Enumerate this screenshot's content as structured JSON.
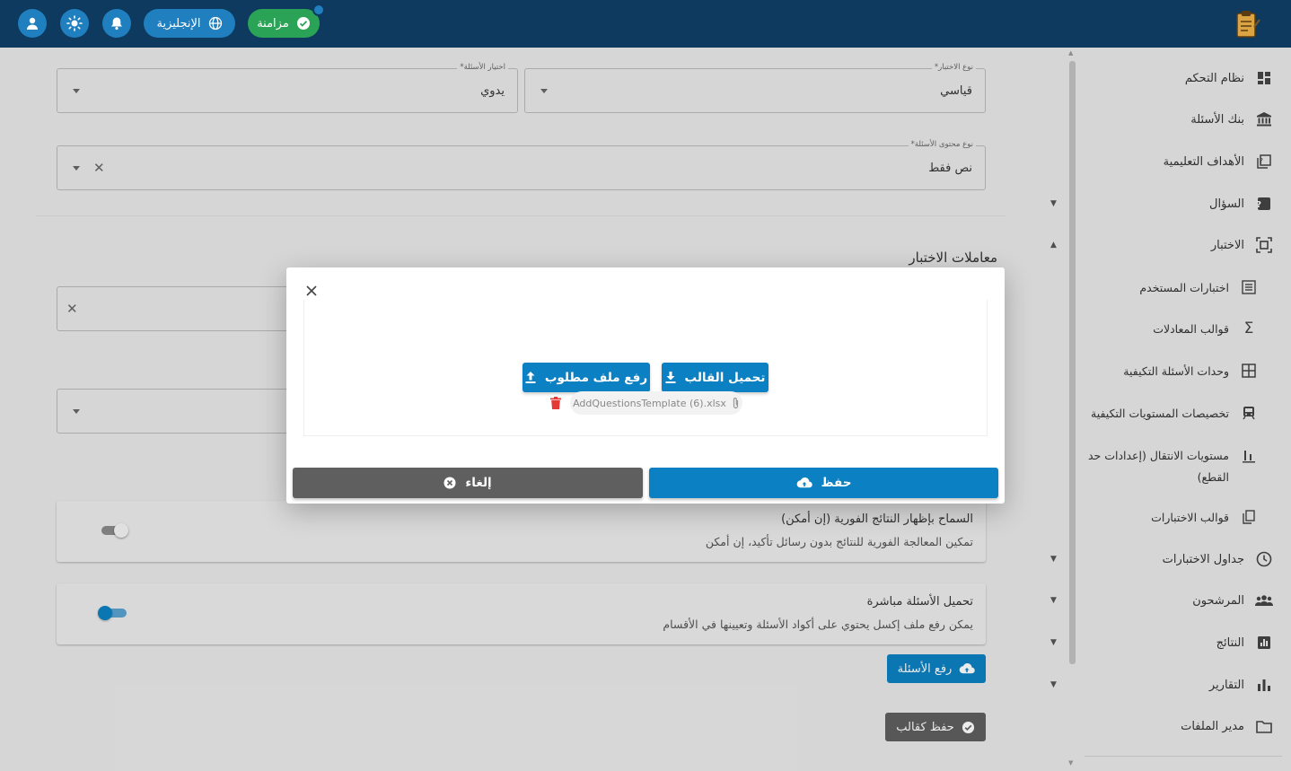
{
  "topbar": {
    "sync_label": "مزامنة",
    "language_label": "الإنجليزية",
    "colors": {
      "bar": "#0e3a5f",
      "accent": "#1f7fbf",
      "sync": "#2aa356"
    }
  },
  "sidebar": {
    "items": [
      {
        "label": "نظام التحكم",
        "icon": "dashboard-icon"
      },
      {
        "label": "بنك الأسئلة",
        "icon": "bank-icon"
      },
      {
        "label": "الأهداف التعليمية",
        "icon": "book-question-icon"
      },
      {
        "label": "السؤال",
        "icon": "question-icon",
        "expandable": true
      },
      {
        "label": "الاختبار",
        "icon": "exam-icon",
        "expanded": true
      },
      {
        "label": "اختبارات المستخدم",
        "icon": "list-icon",
        "sub": true
      },
      {
        "label": "قوالب المعادلات",
        "icon": "sigma-icon",
        "sub": true
      },
      {
        "label": "وحدات الأسئلة التكيفية",
        "icon": "grid-icon",
        "sub": true
      },
      {
        "label": "تخصيصات المستويات التكيفية",
        "icon": "train-icon",
        "sub": true
      },
      {
        "label": "مستويات الانتقال (إعدادات حد القطع)",
        "icon": "bar-chart-icon",
        "sub": true
      },
      {
        "label": "قوالب الاختبارات",
        "icon": "copy-icon",
        "sub": true
      },
      {
        "label": "جداول الاختبارات",
        "icon": "clock-icon",
        "expandable": true
      },
      {
        "label": "المرشحون",
        "icon": "people-icon",
        "expandable": true
      },
      {
        "label": "النتائج",
        "icon": "results-icon",
        "expandable": true
      },
      {
        "label": "التقارير",
        "icon": "reports-icon",
        "expandable": true
      },
      {
        "label": "مدير الملفات",
        "icon": "folder-icon"
      }
    ]
  },
  "form": {
    "exam_type": {
      "label": "نوع الاختبار*",
      "value": "قياسي"
    },
    "question_selection": {
      "label": "اختيار الأسئلة*",
      "value": "يدوي"
    },
    "content_type": {
      "label": "نوع محتوى الأسئلة*",
      "value": "نص فقط"
    },
    "section_title": "معاملات الاختبار"
  },
  "cards": {
    "instant_results": {
      "title": "السماح بإظهار النتائج الفورية (إن أمكن)",
      "desc": "تمكين المعالجة الفورية للنتائج بدون رسائل تأكيد، إن أمكن",
      "enabled": false
    },
    "direct_upload": {
      "title": "تحميل الأسئلة مباشرة",
      "desc": "يمكن رفع ملف إكسل يحتوي على أكواد الأسئلة وتعيينها في الأقسام",
      "enabled": true
    }
  },
  "buttons": {
    "upload_questions": "رفع الأسئلة",
    "save_template": "حفظ كقالب"
  },
  "dialog": {
    "download_template": "تحميل القالب",
    "upload_file": "رفع ملف مطلوب",
    "file_name": "AddQuestionsTemplate (6).xlsx",
    "save": "حفظ",
    "cancel": "إلغاء",
    "colors": {
      "primary": "#0b80c2",
      "cancel": "#5f5f5f",
      "delete": "#e53935"
    }
  }
}
